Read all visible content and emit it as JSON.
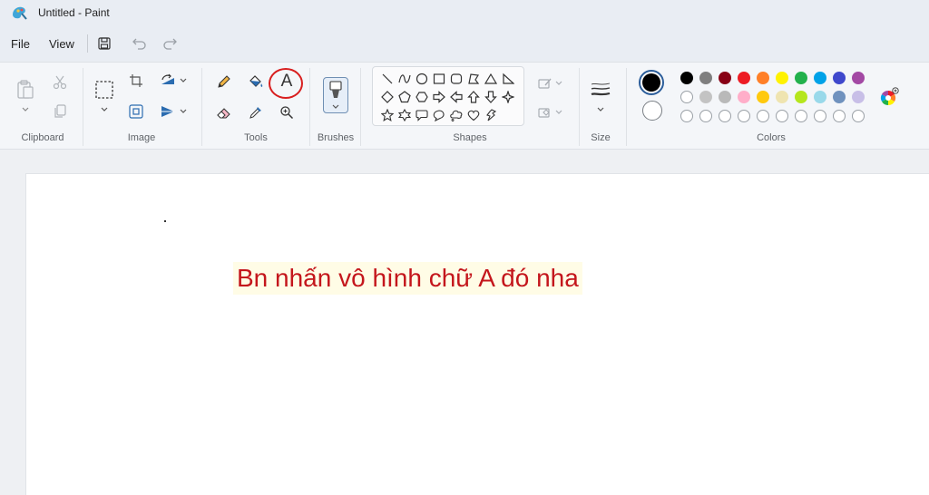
{
  "window": {
    "title": "Untitled - Paint"
  },
  "menu": {
    "file": "File",
    "view": "View"
  },
  "groups": {
    "clipboard": "Clipboard",
    "image": "Image",
    "tools": "Tools",
    "brushes": "Brushes",
    "shapes": "Shapes",
    "size": "Size",
    "colors": "Colors"
  },
  "colors": {
    "primary": "#000000",
    "secondary": "#ffffff",
    "row1": [
      "#000000",
      "#7f7f7f",
      "#880015",
      "#ed1c24",
      "#ff7f27",
      "#fff200",
      "#22b14c",
      "#00a2e8",
      "#3f48cc",
      "#a349a4"
    ],
    "row2": [
      "#ffffff",
      "#c3c3c3",
      "#b9b9b9",
      "#ffaec9",
      "#ffc90e",
      "#efe4b0",
      "#b5e61d",
      "#99d9ea",
      "#7092be",
      "#c8bfe7"
    ],
    "row3_empty_count": 10
  },
  "canvas": {
    "annotation": "Bn nhấn vô hình chữ A đó nha"
  },
  "tools": {
    "text_tool_glyph": "A"
  }
}
